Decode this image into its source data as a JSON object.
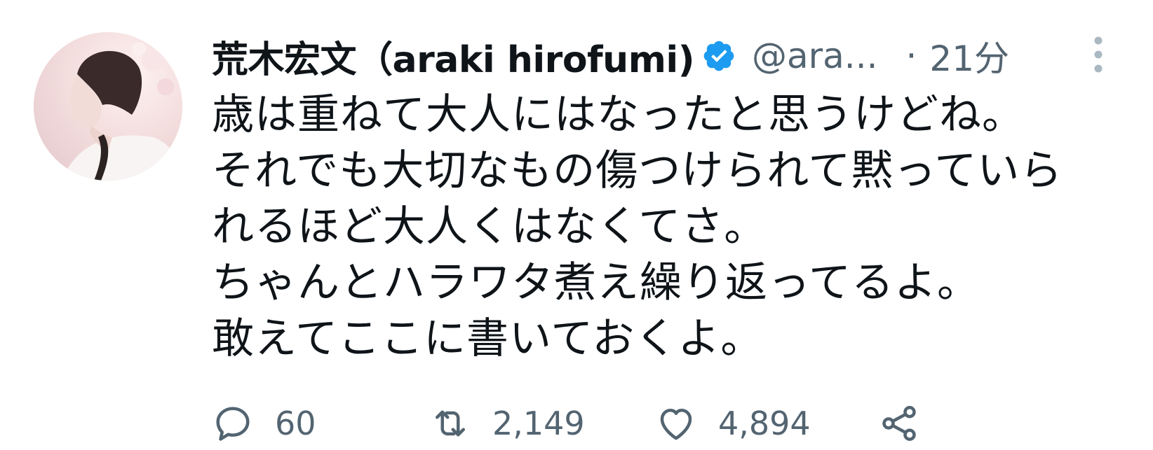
{
  "author": {
    "display_name": "荒木宏文（araki hirofumi)",
    "handle": "@ara...",
    "time": "21分",
    "verified_color": "#1d9bf0"
  },
  "tweet": {
    "lines": [
      "歳は重ねて大人にはなったと思うけどね。",
      "それでも大切なもの傷つけられて黙っていら",
      "れるほど大人くはなくてさ。",
      "ちゃんとハラワタ煮え繰り返ってるよ。",
      "敢えてここに書いておくよ。"
    ]
  },
  "actions": {
    "replies": "60",
    "retweets": "2,149",
    "likes": "4,894"
  },
  "icons": {
    "reply": "reply-icon",
    "retweet": "retweet-icon",
    "like": "heart-icon",
    "share": "share-icon",
    "more": "more-vertical-icon",
    "verified": "verified-badge-icon"
  }
}
